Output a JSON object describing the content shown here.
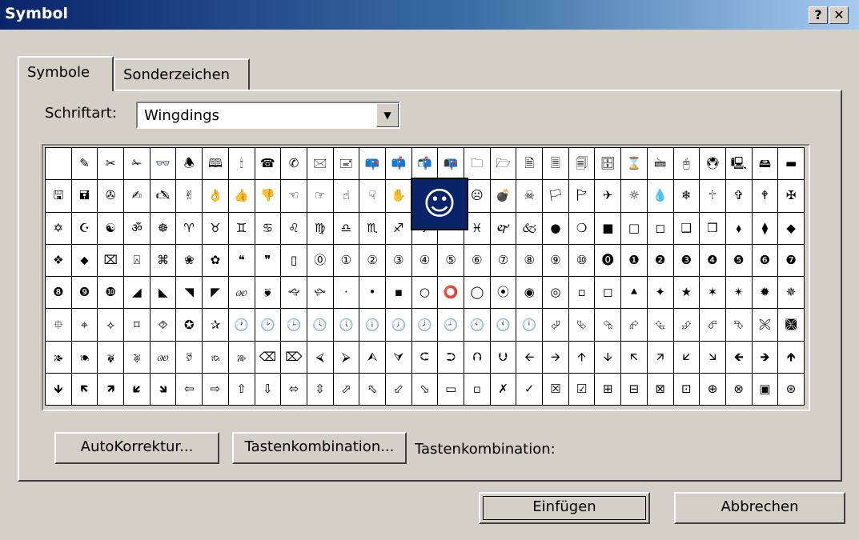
{
  "window": {
    "title": "Symbol",
    "help_label": "?",
    "close_label": "✕"
  },
  "tabs": [
    {
      "label": "Symbole",
      "active": true
    },
    {
      "label": "Sonderzeichen",
      "active": false
    }
  ],
  "font": {
    "label": "Schriftart:",
    "value": "Wingdings"
  },
  "zoomed_symbol": "☺",
  "symbol_rows": [
    [
      " ",
      "✎",
      "✂",
      "✁",
      "👓",
      "🕭",
      "🕮",
      "🕯",
      "☎",
      "✆",
      "🖂",
      "🖃",
      "📪",
      "📫",
      "📬",
      "📭",
      "🗀",
      "🗁",
      "🗎",
      "🗏",
      "🗐",
      "🗄",
      "⌛",
      "🖮",
      "🖰",
      "🖲",
      "🖳",
      "🖴",
      "▬"
    ],
    [
      "🖫",
      "🖬",
      "✇",
      "✍",
      "🖎",
      "✌",
      "👌",
      "👍",
      "👎",
      "☜",
      "☞",
      "☝",
      "☟",
      "✋",
      "☺",
      "😐",
      "☹",
      "💣",
      "☠",
      "🏳",
      "🏱",
      "✈",
      "☼",
      "💧",
      "❄",
      "🕆",
      "✞",
      "🕈",
      "✠"
    ],
    [
      "✡",
      "☪",
      "☯",
      "ॐ",
      "☸",
      "♈",
      "♉",
      "♊",
      "♋",
      "♌",
      "♍",
      "♎",
      "♏",
      "♐",
      "♑",
      "♒",
      "♓",
      "🙰",
      "🙵",
      "●",
      "❍",
      "■",
      "□",
      "◻",
      "❑",
      "❒",
      "⬧",
      "⧫",
      "◆"
    ],
    [
      "❖",
      "⬥",
      "⌧",
      "⍓",
      "⌘",
      "❀",
      "✿",
      "❝",
      "❞",
      "▯",
      "⓪",
      "①",
      "②",
      "③",
      "④",
      "⑤",
      "⑥",
      "⑦",
      "⑧",
      "⑨",
      "⑩",
      "⓿",
      "❶",
      "❷",
      "❸",
      "❹",
      "❺",
      "❻",
      "❼"
    ],
    [
      "❽",
      "❾",
      "❿",
      "◢",
      "◣",
      "◥",
      "◤",
      "🙐",
      "🙘",
      "🙙",
      "🙛",
      "·",
      "•",
      "▪",
      "○",
      "⭕",
      "◯",
      "⦿",
      "◉",
      "◎",
      "▫",
      "◻",
      "⯅",
      "✦",
      "★",
      "✶",
      "✴",
      "✹",
      "✵"
    ],
    [
      "⯐",
      "⌖",
      "⟡",
      "⌑",
      "⯑",
      "✪",
      "✰",
      "🕐",
      "🕑",
      "🕒",
      "🕓",
      "🕔",
      "🕕",
      "🕖",
      "🕗",
      "🕘",
      "🕙",
      "🕚",
      "🕛",
      "⮰",
      "⮱",
      "⮲",
      "⮳",
      "⮴",
      "⮵",
      "⮶",
      "⮷",
      "🙪",
      "🙫"
    ],
    [
      "🙕",
      "🙔",
      "🙗",
      "🙖",
      "🙐",
      "🙑",
      "🙒",
      "🙓",
      "⌫",
      "⌦",
      "⮘",
      "⮚",
      "⮙",
      "⮛",
      "⮈",
      "⮊",
      "⮉",
      "⮋",
      "🡨",
      "🡪",
      "🡩",
      "🡫",
      "🡬",
      "🡭",
      "🡯",
      "🡮",
      "🡸",
      "🡺",
      "🡹"
    ],
    [
      "🡻",
      "🡼",
      "🡽",
      "🡿",
      "🡾",
      "⇦",
      "⇨",
      "⇧",
      "⇩",
      "⬄",
      "⇳",
      "⬀",
      "⬁",
      "⬃",
      "⬂",
      "▭",
      "▫",
      "✗",
      "✓",
      "☒",
      "☑",
      "⊞",
      "⊟",
      "⊠",
      "⊡",
      "⊕",
      "⊗",
      "▣",
      "⊛"
    ]
  ],
  "buttons": {
    "autokorrektur": "AutoKorrektur...",
    "tastenkombination": "Tastenkombination...",
    "einfuegen": "Einfügen",
    "abbrechen": "Abbrechen"
  },
  "shortcut_label": "Tastenkombination:"
}
